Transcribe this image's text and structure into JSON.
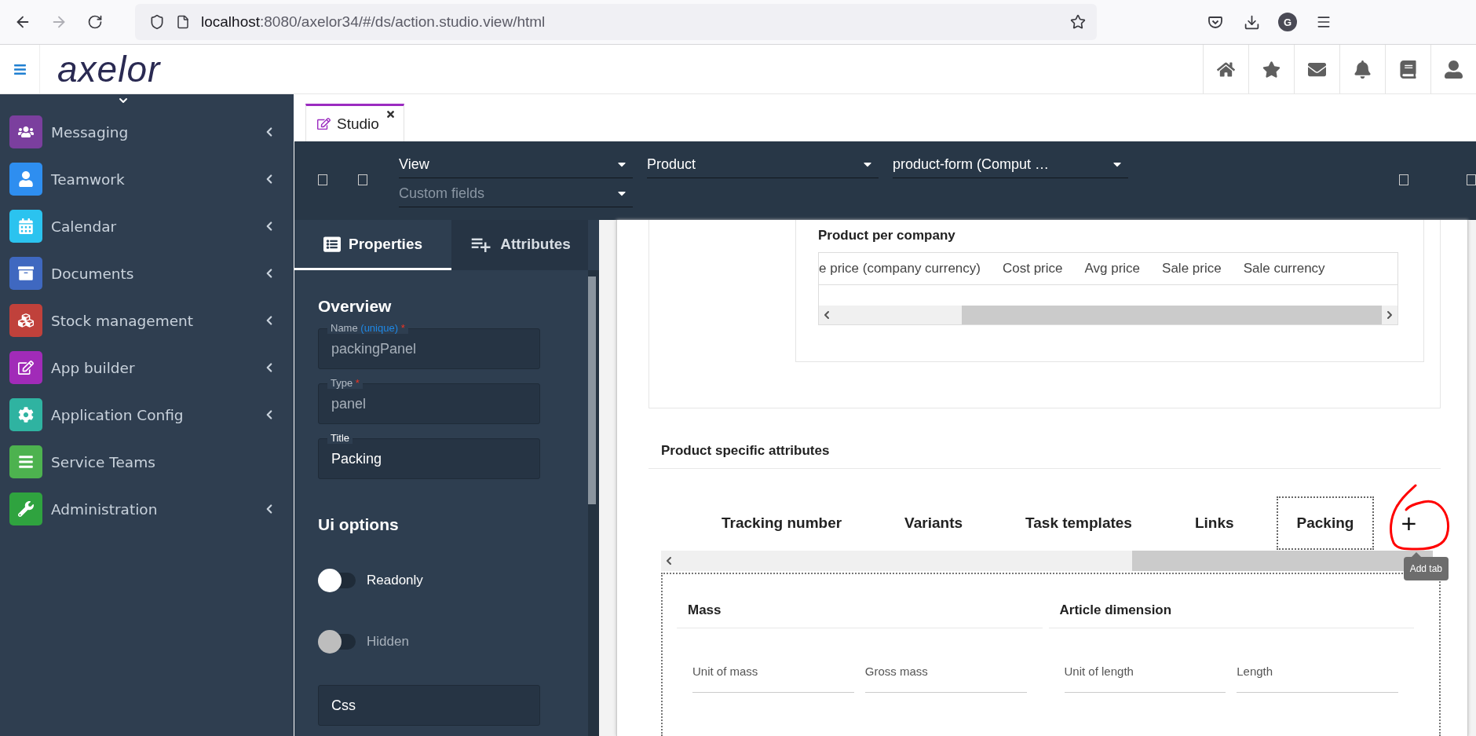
{
  "browser": {
    "url_host": "localhost",
    "url_path": ":8080/axelor34/#/ds/action.studio.view/html",
    "profile_initial": "G"
  },
  "app": {
    "logo": "axelor"
  },
  "sidebar": {
    "items": [
      {
        "label": "Messaging",
        "color": "#7b3f9e",
        "expandable": true
      },
      {
        "label": "Teamwork",
        "color": "#2e8ef0",
        "expandable": true
      },
      {
        "label": "Calendar",
        "color": "#2bc3ef",
        "expandable": true
      },
      {
        "label": "Documents",
        "color": "#3f68c0",
        "expandable": true
      },
      {
        "label": "Stock management",
        "color": "#c0413b",
        "expandable": true
      },
      {
        "label": "App builder",
        "color": "#a12bb8",
        "expandable": true
      },
      {
        "label": "Application Config",
        "color": "#2fb3a1",
        "expandable": true
      },
      {
        "label": "Service Teams",
        "color": "#4db24f",
        "expandable": false
      },
      {
        "label": "Administration",
        "color": "#2fa33f",
        "expandable": true
      }
    ]
  },
  "tabs": [
    {
      "label": "Studio",
      "selected": true
    }
  ],
  "toolbar": {
    "selects": [
      {
        "value": "View",
        "kind": "main"
      },
      {
        "placeholder": "Custom fields",
        "kind": "sub"
      },
      {
        "value": "Product",
        "kind": "main"
      },
      {
        "value": "product-form (Comput …",
        "kind": "main"
      }
    ]
  },
  "properties_panel": {
    "tabs": [
      {
        "label": "Properties",
        "selected": true
      },
      {
        "label": "Attributes",
        "selected": false
      }
    ],
    "overview": {
      "title": "Overview",
      "fields": [
        {
          "label": "Name",
          "hint": "(unique)",
          "required_mark": "*",
          "value": "packingPanel",
          "disabled": true
        },
        {
          "label": "Type",
          "required_mark": "*",
          "value": "panel",
          "disabled": true
        },
        {
          "label": "Title",
          "value": "Packing",
          "disabled": false
        }
      ]
    },
    "ui_options": {
      "title": "Ui options",
      "toggles": [
        {
          "label": "Readonly",
          "on": false,
          "disabled": false
        },
        {
          "label": "Hidden",
          "on": false,
          "disabled": true
        }
      ],
      "css_field": {
        "placeholder": "Css"
      }
    }
  },
  "canvas": {
    "product_per_company": {
      "title": "Product per company",
      "columns": [
        "e price (company currency)",
        "Cost price",
        "Avg price",
        "Sale price",
        "Sale currency"
      ]
    },
    "section_title": "Product specific attributes",
    "tabs": [
      {
        "label": "Tracking number",
        "selected": false
      },
      {
        "label": "Variants",
        "selected": false
      },
      {
        "label": "Task templates",
        "selected": false
      },
      {
        "label": "Links",
        "selected": false
      },
      {
        "label": "Packing",
        "selected": true
      }
    ],
    "add_tab": {
      "label": "+",
      "tooltip": "Add tab"
    },
    "panels": [
      {
        "title": "Mass",
        "fields": [
          "Unit of mass",
          "Gross mass"
        ]
      },
      {
        "title": "Article dimension",
        "fields": [
          "Unit of length",
          "Length"
        ]
      }
    ]
  }
}
